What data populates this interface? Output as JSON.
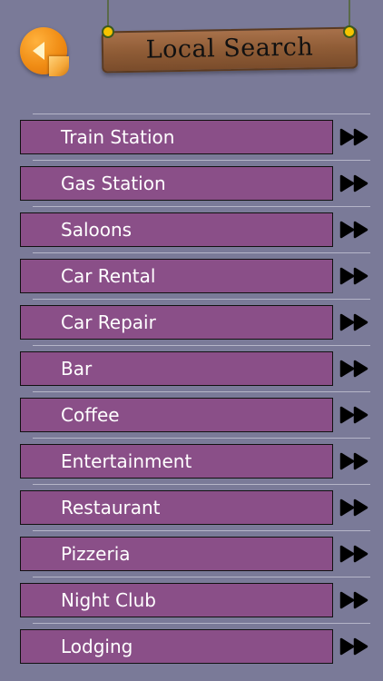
{
  "header": {
    "title": "Local Search",
    "back_icon": "back-arrow-icon"
  },
  "colors": {
    "background": "#7a7a98",
    "item_fill": "#8a4f88",
    "item_text": "#ffffff",
    "accent_back": "#f08c14",
    "sign_wood": "#8f5c36"
  },
  "list": {
    "row_icon": "fast-forward-icon",
    "items": [
      {
        "label": "Train Station"
      },
      {
        "label": "Gas Station"
      },
      {
        "label": "Saloons"
      },
      {
        "label": "Car Rental"
      },
      {
        "label": "Car Repair"
      },
      {
        "label": "Bar"
      },
      {
        "label": "Coffee"
      },
      {
        "label": "Entertainment"
      },
      {
        "label": "Restaurant"
      },
      {
        "label": "Pizzeria"
      },
      {
        "label": "Night Club"
      },
      {
        "label": "Lodging"
      }
    ]
  }
}
